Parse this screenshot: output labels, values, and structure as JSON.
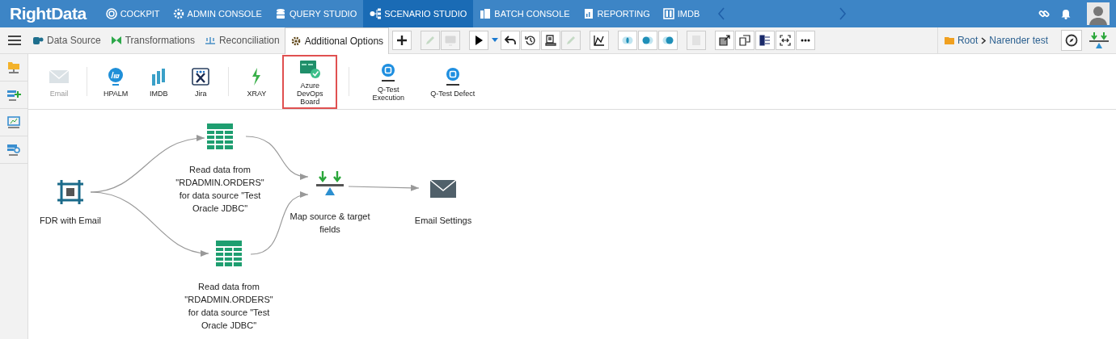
{
  "app": {
    "logo": "RightData"
  },
  "nav": [
    {
      "label": "COCKPIT",
      "selected": false
    },
    {
      "label": "ADMIN CONSOLE",
      "selected": false
    },
    {
      "label": "QUERY STUDIO",
      "selected": false
    },
    {
      "label": "SCENARIO STUDIO",
      "selected": true
    },
    {
      "label": "BATCH CONSOLE",
      "selected": false
    },
    {
      "label": "REPORTING",
      "selected": false
    },
    {
      "label": "IMDB",
      "selected": false
    }
  ],
  "tabs": [
    {
      "label": "Data Source",
      "selected": false
    },
    {
      "label": "Transformations",
      "selected": false
    },
    {
      "label": "Reconciliation",
      "selected": false
    },
    {
      "label": "Additional Options",
      "selected": true
    }
  ],
  "tools": [
    {
      "kind": "add",
      "disabled": false
    },
    {
      "kind": "edit",
      "disabled": true
    },
    {
      "kind": "monitor",
      "disabled": true
    },
    {
      "kind": "play",
      "disabled": false
    },
    {
      "kind": "undo",
      "disabled": false
    },
    {
      "kind": "history",
      "disabled": false
    },
    {
      "kind": "report",
      "disabled": false
    },
    {
      "kind": "edit",
      "disabled": true
    },
    {
      "kind": "chart",
      "disabled": false
    },
    {
      "kind": "inner",
      "disabled": false
    },
    {
      "kind": "left",
      "disabled": false
    },
    {
      "kind": "right",
      "disabled": false
    },
    {
      "kind": "columns",
      "disabled": true
    },
    {
      "kind": "export",
      "disabled": false
    },
    {
      "kind": "copy",
      "disabled": false
    },
    {
      "kind": "split",
      "disabled": false
    },
    {
      "kind": "fit",
      "disabled": false
    },
    {
      "kind": "more",
      "disabled": false
    }
  ],
  "breadcrumb": {
    "root": "Root",
    "current": "Narender test"
  },
  "options": [
    {
      "label": "Email",
      "disabled": true,
      "selected": false
    },
    {
      "label": "HPALM",
      "disabled": false,
      "selected": false
    },
    {
      "label": "IMDB",
      "disabled": false,
      "selected": false
    },
    {
      "label": "Jira",
      "disabled": false,
      "selected": false
    },
    {
      "label": "XRAY",
      "disabled": false,
      "selected": false
    },
    {
      "label": "Azure DevOps Board",
      "disabled": false,
      "selected": true
    },
    {
      "label": "Q-Test Execution",
      "disabled": false,
      "selected": false
    },
    {
      "label": "Q-Test Defect",
      "disabled": false,
      "selected": false
    }
  ],
  "nodes": [
    {
      "kind": "fdr",
      "label": "FDR with Email"
    },
    {
      "kind": "table",
      "label": "Read data from \"RDADMIN.ORDERS\" for data source \"Test Oracle JDBC\""
    },
    {
      "kind": "table",
      "label": "Read data from \"RDADMIN.ORDERS\" for data source \"Test Oracle JDBC\""
    },
    {
      "kind": "map",
      "label": "Map source & target fields"
    },
    {
      "kind": "mail",
      "label": "Email Settings"
    }
  ]
}
